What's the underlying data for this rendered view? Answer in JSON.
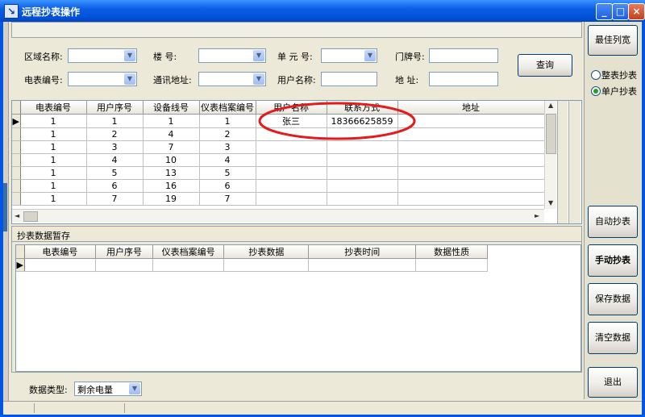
{
  "window": {
    "title": "远程抄表操作"
  },
  "filters": {
    "area_label": "区域名称:",
    "building_label": "楼    号:",
    "unit_label": "单 元 号:",
    "door_label": "门牌号:",
    "meter_label": "电表编号:",
    "comm_label": "通讯地址:",
    "username_label": "用户名称:",
    "address_label": "地  址:",
    "query_label": "查询"
  },
  "right_panel": {
    "best_width_label": "最佳列宽",
    "radio_whole": "整表抄表",
    "radio_single": "单户抄表",
    "auto_label": "自动抄表",
    "manual_label": "手动抄表",
    "save_label": "保存数据",
    "clear_label": "清空数据",
    "exit_label": "退出"
  },
  "user_table": {
    "headers": [
      "电表编号",
      "用户序号",
      "设备线号",
      "仪表档案编号",
      "用户名称",
      "联系方式",
      "地址"
    ],
    "rows": [
      [
        "1",
        "1",
        "1",
        "1",
        "张三",
        "18366625859",
        ""
      ],
      [
        "1",
        "2",
        "4",
        "2",
        "",
        "",
        ""
      ],
      [
        "1",
        "3",
        "7",
        "3",
        "",
        "",
        ""
      ],
      [
        "1",
        "4",
        "10",
        "4",
        "",
        "",
        ""
      ],
      [
        "1",
        "5",
        "13",
        "5",
        "",
        "",
        ""
      ],
      [
        "1",
        "6",
        "16",
        "6",
        "",
        "",
        ""
      ],
      [
        "1",
        "7",
        "19",
        "7",
        "",
        "",
        ""
      ]
    ]
  },
  "temp_section": {
    "title": "抄表数据暂存",
    "headers": [
      "电表编号",
      "用户序号",
      "仪表档案编号",
      "抄表数据",
      "抄表时间",
      "数据性质"
    ]
  },
  "footer": {
    "data_type_label": "数据类型:",
    "data_type_value": "剩余电量"
  }
}
